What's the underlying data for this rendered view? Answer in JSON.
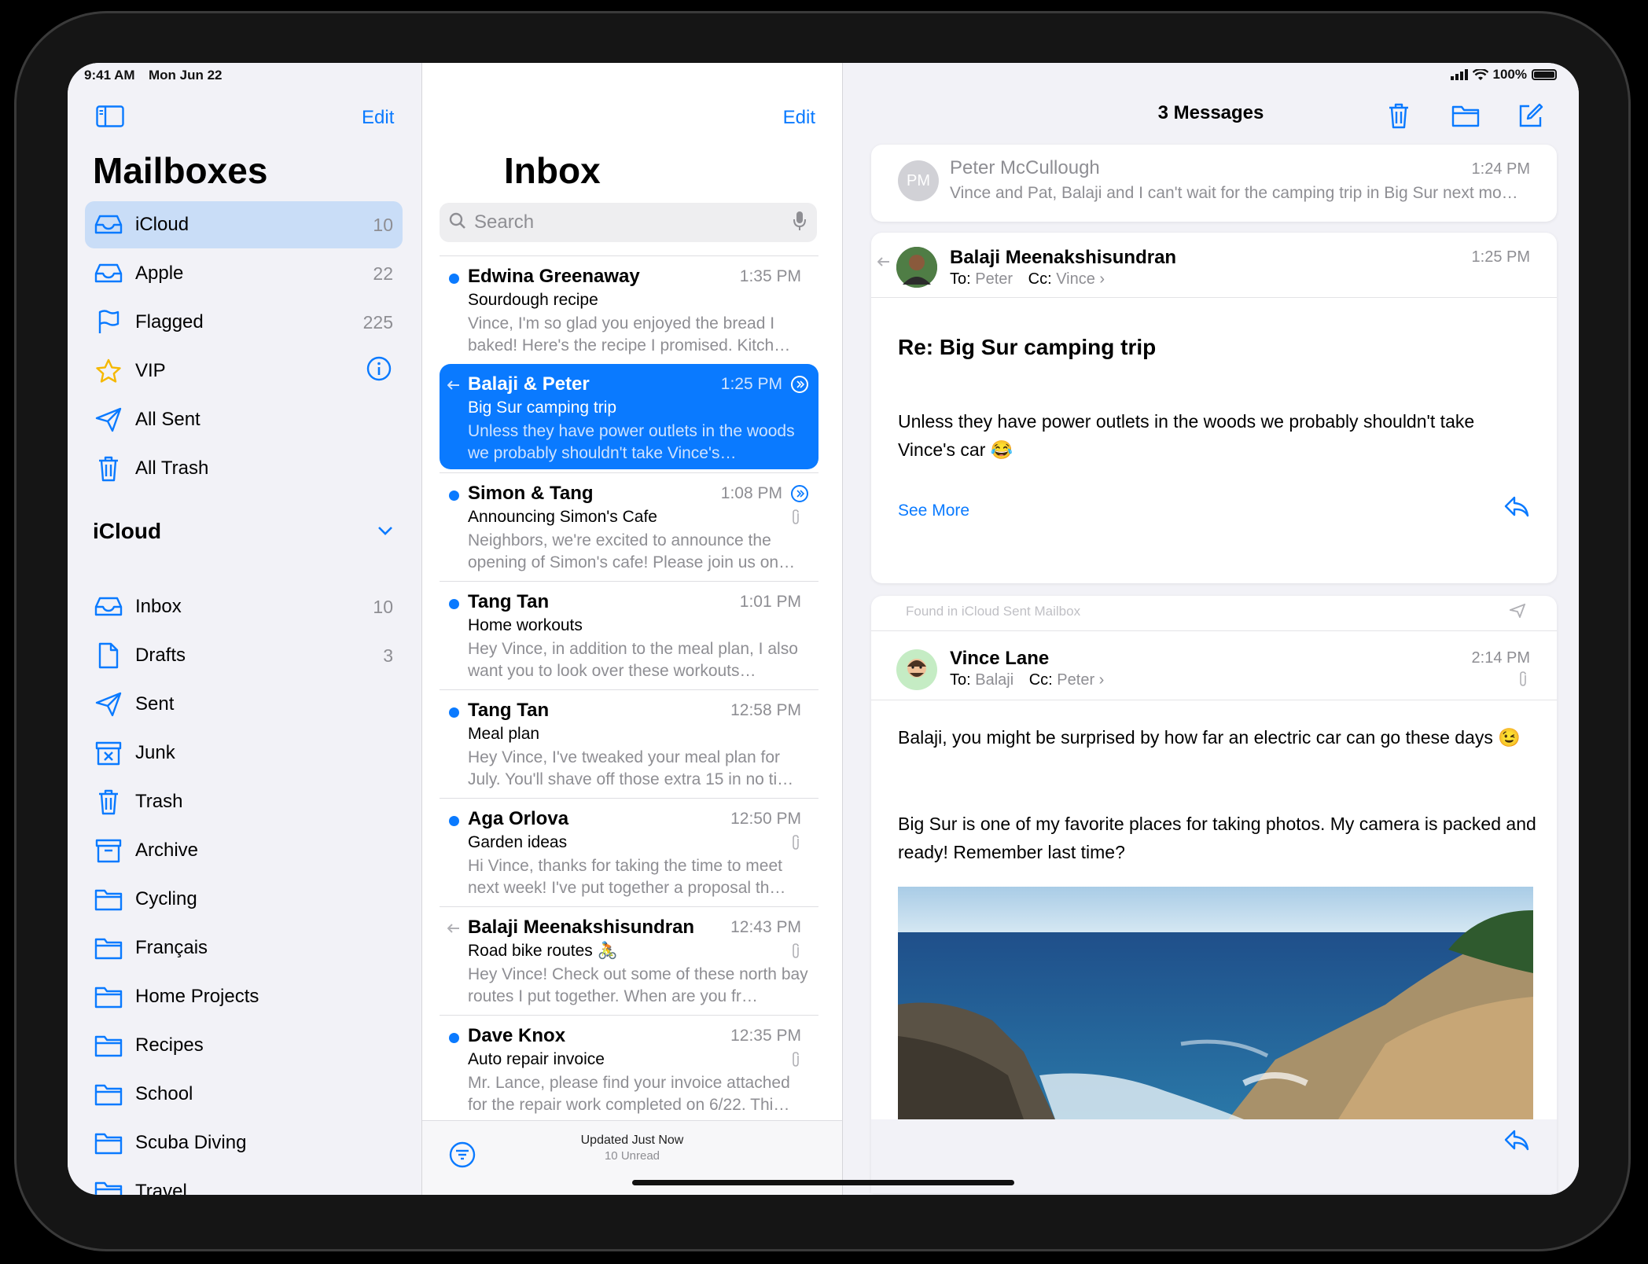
{
  "status_bar": {
    "time": "9:41 AM",
    "date": "Mon Jun 22",
    "battery": "100%"
  },
  "sidebar": {
    "edit_label": "Edit",
    "title": "Mailboxes",
    "mailboxes": [
      {
        "label": "iCloud",
        "count": "10",
        "icon": "tray-icon",
        "selected": true
      },
      {
        "label": "Apple",
        "count": "22",
        "icon": "tray-icon"
      },
      {
        "label": "Flagged",
        "count": "225",
        "icon": "flag-icon"
      },
      {
        "label": "VIP",
        "count": "",
        "icon": "star-icon"
      },
      {
        "label": "All Sent",
        "count": "",
        "icon": "paperplane-icon"
      },
      {
        "label": "All Trash",
        "count": "",
        "icon": "trash-icon"
      }
    ],
    "section_title": "iCloud",
    "folders": [
      {
        "label": "Inbox",
        "count": "10",
        "icon": "tray-icon"
      },
      {
        "label": "Drafts",
        "count": "3",
        "icon": "document-icon"
      },
      {
        "label": "Sent",
        "count": "",
        "icon": "paperplane-icon"
      },
      {
        "label": "Junk",
        "count": "",
        "icon": "junk-icon"
      },
      {
        "label": "Trash",
        "count": "",
        "icon": "trash-icon"
      },
      {
        "label": "Archive",
        "count": "",
        "icon": "archive-icon"
      },
      {
        "label": "Cycling",
        "count": "",
        "icon": "folder-icon"
      },
      {
        "label": "Français",
        "count": "",
        "icon": "folder-icon"
      },
      {
        "label": "Home Projects",
        "count": "",
        "icon": "folder-icon"
      },
      {
        "label": "Recipes",
        "count": "",
        "icon": "folder-icon"
      },
      {
        "label": "School",
        "count": "",
        "icon": "folder-icon"
      },
      {
        "label": "Scuba Diving",
        "count": "",
        "icon": "folder-icon"
      },
      {
        "label": "Travel",
        "count": "",
        "icon": "folder-icon"
      }
    ]
  },
  "inbox": {
    "edit_label": "Edit",
    "title": "Inbox",
    "search_placeholder": "Search",
    "messages": [
      {
        "sender": "Edwina Greenaway",
        "time": "1:35 PM",
        "subject": "Sourdough recipe",
        "preview": "Vince, I'm so glad you enjoyed the bread I baked! Here's the recipe I promised. Kitch…",
        "unread": true
      },
      {
        "sender": "Balaji & Peter",
        "time": "1:25 PM",
        "subject": "Big Sur camping trip",
        "preview": "Unless they have power outlets in the woods we probably shouldn't take Vince's…",
        "selected": true,
        "replied": true
      },
      {
        "sender": "Simon & Tang",
        "time": "1:08 PM",
        "subject": "Announcing Simon's Cafe",
        "preview": "Neighbors, we're excited to announce the opening of Simon's cafe! Please join us on…",
        "unread": true,
        "attachment": true
      },
      {
        "sender": "Tang Tan",
        "time": "1:01 PM",
        "subject": "Home workouts",
        "preview": "Hey Vince, in addition to the meal plan, I also want you to look over these workouts…",
        "unread": true
      },
      {
        "sender": "Tang Tan",
        "time": "12:58 PM",
        "subject": "Meal plan",
        "preview": "Hey Vince, I've tweaked your meal plan for July. You'll shave off those extra 15 in no ti…",
        "unread": true
      },
      {
        "sender": "Aga Orlova",
        "time": "12:50 PM",
        "subject": "Garden ideas",
        "preview": "Hi Vince, thanks for taking the time to meet next week! I've put together a proposal th…",
        "unread": true,
        "attachment": true
      },
      {
        "sender": "Balaji Meenakshisundran",
        "time": "12:43 PM",
        "subject": "Road bike routes 🚴",
        "preview": "Hey Vince! Check out some of these north bay routes I put together. When are you fr…",
        "replied": true,
        "attachment": true
      },
      {
        "sender": "Dave Knox",
        "time": "12:35 PM",
        "subject": "Auto repair invoice",
        "preview": "Mr. Lance, please find your invoice attached for the repair work completed on 6/22. Thi…",
        "unread": true,
        "attachment": true
      }
    ],
    "footer_status": "Updated Just Now",
    "footer_unread": "10 Unread"
  },
  "detail": {
    "header_title": "3 Messages",
    "collapsed": {
      "initials": "PM",
      "sender": "Peter McCullough",
      "time": "1:24 PM",
      "preview": "Vince and Pat, Balaji and I can't wait for the camping trip in Big Sur next mo…"
    },
    "message1": {
      "sender": "Balaji Meenakshisundran",
      "time": "1:25 PM",
      "to_label": "To:",
      "to": "Peter",
      "cc_label": "Cc:",
      "cc": "Vince",
      "subject": "Re: Big Sur camping trip",
      "body": "Unless they have power outlets in the woods we probably shouldn't take Vince's car 😂",
      "see_more": "See More"
    },
    "message2": {
      "found_in": "Found in iCloud Sent Mailbox",
      "sender": "Vince Lane",
      "time": "2:14 PM",
      "to_label": "To:",
      "to": "Balaji",
      "cc_label": "Cc:",
      "cc": "Peter",
      "body1": "Balaji, you might be surprised by how far an electric car can go these days 😉",
      "body2": "Big Sur is one of my favorite places for taking photos. My camera is packed and ready! Remember last time?"
    }
  },
  "colors": {
    "accent": "#0a7aff",
    "selected_sidebar": "#c9ddf7",
    "secondary_text": "#8e8e93"
  }
}
